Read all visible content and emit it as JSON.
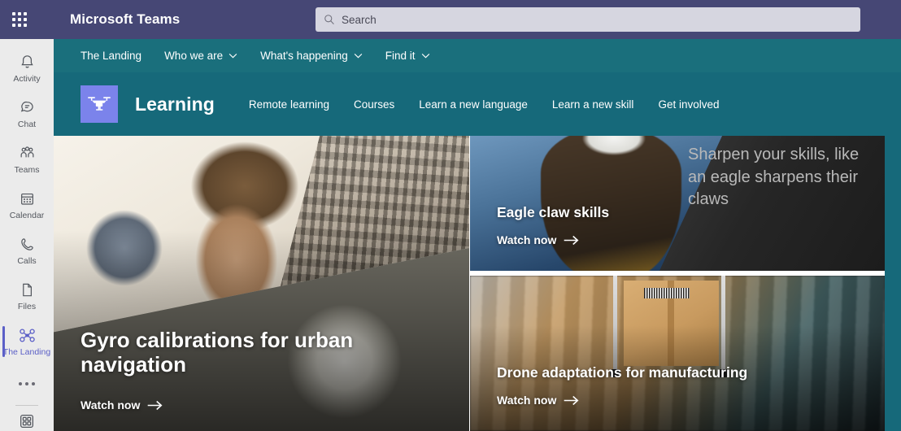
{
  "topbar": {
    "app_title": "Microsoft Teams",
    "waffle_icon": "app-launcher-grid-icon",
    "search": {
      "placeholder": "Search",
      "value": "",
      "icon": "search-icon"
    }
  },
  "rail": {
    "items": [
      {
        "label": "Activity",
        "icon": "bell-icon",
        "active": false
      },
      {
        "label": "Chat",
        "icon": "chat-bubble-icon",
        "active": false
      },
      {
        "label": "Teams",
        "icon": "people-icon",
        "active": false
      },
      {
        "label": "Calendar",
        "icon": "calendar-icon",
        "active": false
      },
      {
        "label": "Calls",
        "icon": "phone-icon",
        "active": false
      },
      {
        "label": "Files",
        "icon": "document-icon",
        "active": false
      },
      {
        "label": "The Landing",
        "icon": "drone-icon",
        "active": true
      }
    ],
    "more_icon": "ellipsis-icon",
    "store_icon": "apps-store-icon"
  },
  "sitenav": {
    "items": [
      {
        "label": "The Landing",
        "has_chevron": false
      },
      {
        "label": "Who we are",
        "has_chevron": true
      },
      {
        "label": "What's happening",
        "has_chevron": true
      },
      {
        "label": "Find it",
        "has_chevron": true
      }
    ]
  },
  "siteheader": {
    "logo_icon": "drone-icon",
    "site_name": "Learning",
    "links": [
      "Remote learning",
      "Courses",
      "Learn a new language",
      "Learn a new skill",
      "Get involved"
    ]
  },
  "cards": {
    "hero": {
      "title": "Gyro calibrations for urban navigation",
      "cta": "Watch now",
      "cta_icon": "arrow-right-icon"
    },
    "eagle": {
      "title": "Eagle claw skills",
      "cta": "Watch now",
      "cta_icon": "arrow-right-icon",
      "quote": "Sharpen your skills, like an eagle sharpens their claws"
    },
    "drone": {
      "title": "Drone adaptations for manufacturing",
      "cta": "Watch now",
      "cta_icon": "arrow-right-icon"
    }
  },
  "colors": {
    "teams_purple": "#464775",
    "teams_accent": "#5b5fc7",
    "site_teal": "#16697a",
    "site_nav_teal": "#1a6f7c",
    "logo_tile": "#7b83eb",
    "rail_bg": "#ebebeb",
    "search_bg": "#d6d6e0"
  }
}
